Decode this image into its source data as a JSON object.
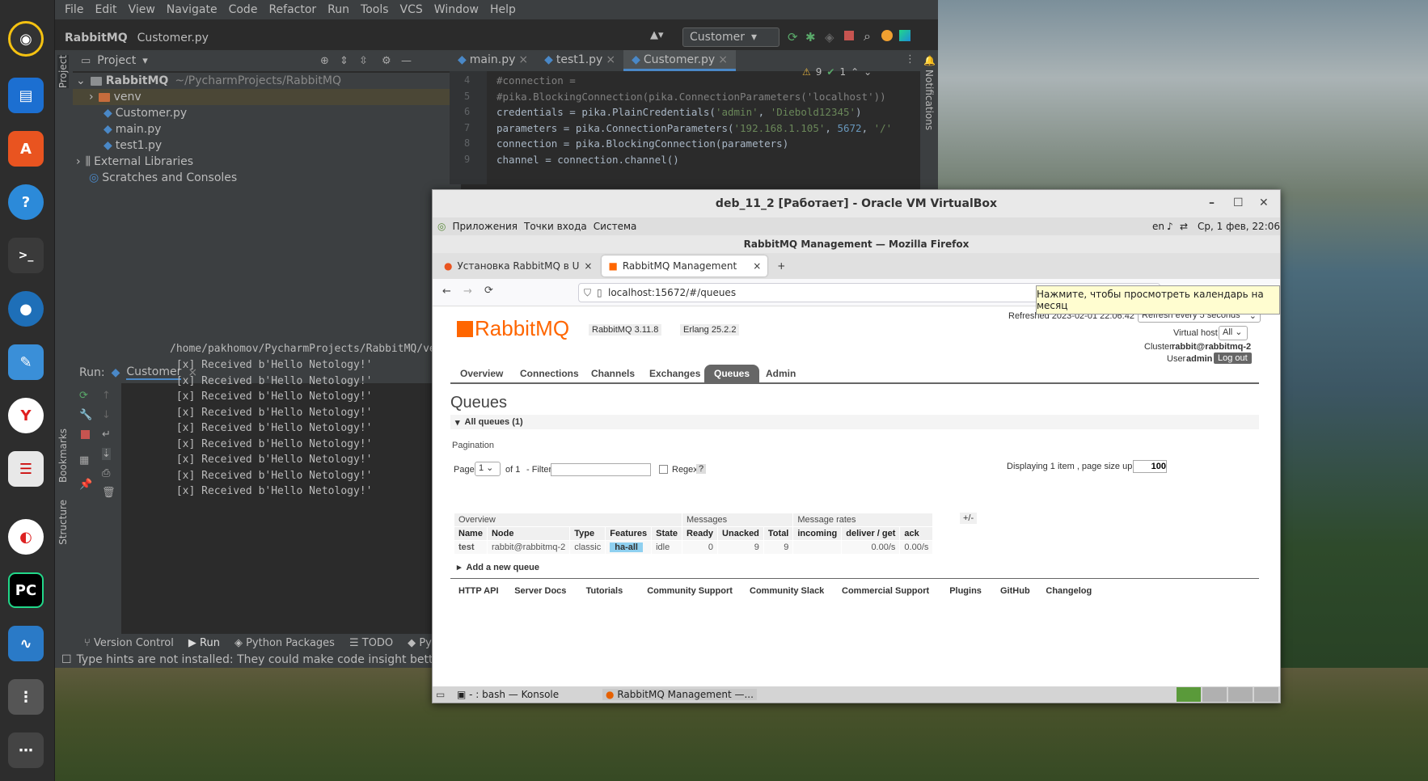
{
  "ide": {
    "menu": [
      "File",
      "Edit",
      "View",
      "Navigate",
      "Code",
      "Refactor",
      "Run",
      "Tools",
      "VCS",
      "Window",
      "Help"
    ],
    "breadcrumb": [
      "RabbitMQ",
      "Customer.py"
    ],
    "run_config": "Customer",
    "project_label": "Project",
    "tree": {
      "root": "RabbitMQ",
      "root_path": "~/PycharmProjects/RabbitMQ",
      "venv": "venv",
      "files": [
        "Customer.py",
        "main.py",
        "test1.py"
      ],
      "external": "External Libraries",
      "scratches": "Scratches and Consoles"
    },
    "tabs": [
      "main.py",
      "test1.py",
      "Customer.py"
    ],
    "inspections": {
      "warnings": "9",
      "ok": "1"
    },
    "code_lines": [
      {
        "n": "4",
        "parts": [
          {
            "t": "#connection =",
            "c": "kw-com"
          }
        ]
      },
      {
        "n": "5",
        "parts": [
          {
            "t": "#pika.BlockingConnection(pika.ConnectionParameters('localhost'))",
            "c": "kw-com"
          }
        ]
      },
      {
        "n": "6",
        "parts": [
          {
            "t": "credentials = pika.PlainCredentials(",
            "c": ""
          },
          {
            "t": "'admin'",
            "c": "kw-str"
          },
          {
            "t": ", ",
            "c": ""
          },
          {
            "t": "'Diebold12345'",
            "c": "kw-str"
          },
          {
            "t": ")",
            "c": ""
          }
        ]
      },
      {
        "n": "7",
        "parts": [
          {
            "t": "parameters = pika.ConnectionParameters(",
            "c": ""
          },
          {
            "t": "'192.168.1.105'",
            "c": "kw-str"
          },
          {
            "t": ", ",
            "c": ""
          },
          {
            "t": "5672",
            "c": "kw-num"
          },
          {
            "t": ", ",
            "c": ""
          },
          {
            "t": "'/'",
            "c": "kw-str"
          }
        ]
      },
      {
        "n": "8",
        "parts": [
          {
            "t": "connection = pika.BlockingConnection(parameters)",
            "c": ""
          }
        ]
      },
      {
        "n": "9",
        "parts": [
          {
            "t": "channel = connection.channel()",
            "c": ""
          }
        ]
      }
    ],
    "run_label": "Run:",
    "run_tab": "Customer",
    "run_path": "/home/pakhomov/PycharmProjects/RabbitMQ/venv/bi",
    "run_output": [
      " [x] Received b'Hello Netology!'",
      " [x] Received b'Hello Netology!'",
      " [x] Received b'Hello Netology!'",
      " [x] Received b'Hello Netology!'",
      " [x] Received b'Hello Netology!'",
      " [x] Received b'Hello Netology!'",
      " [x] Received b'Hello Netology!'",
      " [x] Received b'Hello Netology!'",
      " [x] Received b'Hello Netology!'"
    ],
    "tool_tabs": [
      "Version Control",
      "Run",
      "Python Packages",
      "TODO",
      "Pyt"
    ],
    "status": "Type hints are not installed: They could make code insight better. /",
    "side_labels": {
      "project": "Project",
      "bookmarks": "Bookmarks",
      "structure": "Structure",
      "notifications": "Notifications"
    }
  },
  "vbox": {
    "title": "deb_11_2 [Работает] - Oracle VM VirtualBox",
    "guest_menu": [
      "Приложения",
      "Точки входа",
      "Система"
    ],
    "guest_tray": {
      "lang": "en",
      "clock": "Ср, 1 фев, 22:06"
    },
    "tooltip": "Нажмите, чтобы просмотреть календарь на месяц",
    "ff_title": "RabbitMQ Management — Mozilla Firefox",
    "ff_tabs": [
      "Установка RabbitMQ в U",
      "RabbitMQ Management"
    ],
    "url": "localhost:15672/#/queues",
    "taskbar": [
      "- : bash — Konsole",
      "RabbitMQ Management —..."
    ]
  },
  "rmq": {
    "logo": "RabbitMQ",
    "version": "RabbitMQ 3.11.8",
    "erlang": "Erlang 25.2.2",
    "refreshed": "Refreshed 2023-02-01 22:06:42",
    "refresh_option": "Refresh every 5 seconds",
    "vhost_label": "Virtual host",
    "vhost": "All",
    "cluster_label": "Cluster",
    "cluster": "rabbit@rabbitmq-2",
    "user_label": "User",
    "user": "admin",
    "logout": "Log out",
    "nav": [
      "Overview",
      "Connections",
      "Channels",
      "Exchanges",
      "Queues",
      "Admin"
    ],
    "heading": "Queues",
    "section": "All queues (1)",
    "pagination": "Pagination",
    "page_label": "Page",
    "page": "1",
    "of": "of 1",
    "filter_label": "- Filter:",
    "regex": "Regex",
    "help": "?",
    "displaying": "Displaying 1 item , page size up to:",
    "page_size": "100",
    "table": {
      "groups": [
        "Overview",
        "Messages",
        "Message rates"
      ],
      "plus": "+/-",
      "headers": [
        "Name",
        "Node",
        "Type",
        "Features",
        "State",
        "Ready",
        "Unacked",
        "Total",
        "incoming",
        "deliver / get",
        "ack"
      ],
      "row": [
        "test",
        "rabbit@rabbitmq-2",
        "classic",
        "ha-all",
        "idle",
        "0",
        "9",
        "9",
        "",
        "0.00/s",
        "0.00/s"
      ]
    },
    "add_queue": "Add a new queue",
    "footer": [
      "HTTP API",
      "Server Docs",
      "Tutorials",
      "Community Support",
      "Community Slack",
      "Commercial Support",
      "Plugins",
      "GitHub",
      "Changelog"
    ]
  },
  "colors": {
    "accent": "#f60",
    "badge": "#8fd0f0"
  }
}
